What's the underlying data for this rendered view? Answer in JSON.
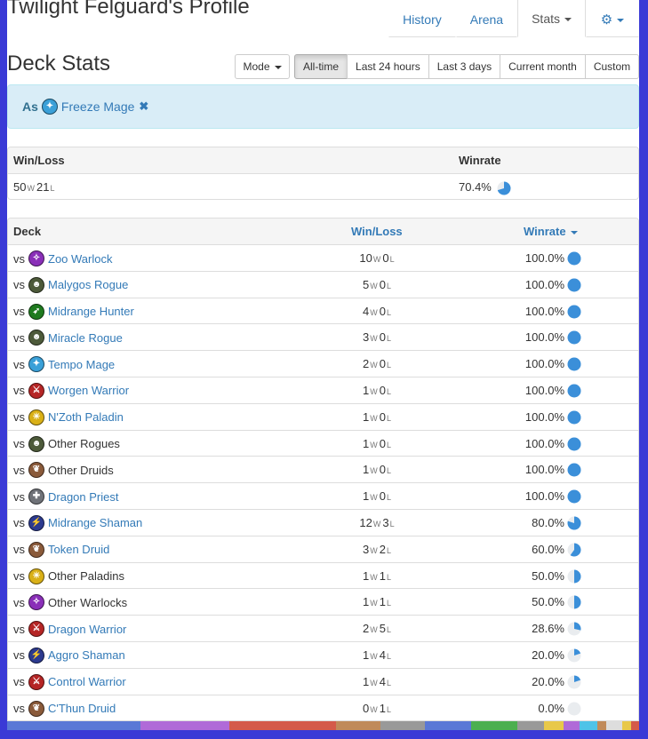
{
  "header": {
    "profile_title": "Twilight Felguard's Profile",
    "nav": [
      {
        "label": "History",
        "active": false
      },
      {
        "label": "Arena",
        "active": false
      },
      {
        "label": "Stats",
        "active": true
      }
    ],
    "settings_icon": "gear-icon"
  },
  "deck_stats": {
    "title": "Deck Stats",
    "mode_label": "Mode",
    "ranges": [
      "All-time",
      "Last 24 hours",
      "Last 3 days",
      "Current month",
      "Custom"
    ],
    "active_range": "All-time"
  },
  "filter": {
    "as_label": "As",
    "deck": "Freeze Mage",
    "deck_class": "mage",
    "remove_icon": "times-icon"
  },
  "summary": {
    "headers": {
      "winloss": "Win/Loss",
      "winrate": "Winrate"
    },
    "wins": "50",
    "losses": "21",
    "winrate": "70.4%",
    "winrate_value": 0.704
  },
  "table": {
    "headers": {
      "deck": "Deck",
      "winloss": "Win/Loss",
      "winrate": "Winrate"
    },
    "vs_label": "vs",
    "w_suffix": "W",
    "l_suffix": "L",
    "rows": [
      {
        "deck": "Zoo Warlock",
        "cls": "warlock",
        "link": true,
        "w": "10",
        "l": "0",
        "winrate": "100.0%",
        "rate": 1.0
      },
      {
        "deck": "Malygos Rogue",
        "cls": "rogue",
        "link": true,
        "w": "5",
        "l": "0",
        "winrate": "100.0%",
        "rate": 1.0
      },
      {
        "deck": "Midrange Hunter",
        "cls": "hunter",
        "link": true,
        "w": "4",
        "l": "0",
        "winrate": "100.0%",
        "rate": 1.0
      },
      {
        "deck": "Miracle Rogue",
        "cls": "rogue",
        "link": true,
        "w": "3",
        "l": "0",
        "winrate": "100.0%",
        "rate": 1.0
      },
      {
        "deck": "Tempo Mage",
        "cls": "mage",
        "link": true,
        "w": "2",
        "l": "0",
        "winrate": "100.0%",
        "rate": 1.0
      },
      {
        "deck": "Worgen Warrior",
        "cls": "warrior",
        "link": true,
        "w": "1",
        "l": "0",
        "winrate": "100.0%",
        "rate": 1.0
      },
      {
        "deck": "N'Zoth Paladin",
        "cls": "paladin",
        "link": true,
        "w": "1",
        "l": "0",
        "winrate": "100.0%",
        "rate": 1.0
      },
      {
        "deck": "Other Rogues",
        "cls": "rogue",
        "link": false,
        "w": "1",
        "l": "0",
        "winrate": "100.0%",
        "rate": 1.0
      },
      {
        "deck": "Other Druids",
        "cls": "druid",
        "link": false,
        "w": "1",
        "l": "0",
        "winrate": "100.0%",
        "rate": 1.0
      },
      {
        "deck": "Dragon Priest",
        "cls": "priest",
        "link": true,
        "w": "1",
        "l": "0",
        "winrate": "100.0%",
        "rate": 1.0
      },
      {
        "deck": "Midrange Shaman",
        "cls": "shaman",
        "link": true,
        "w": "12",
        "l": "3",
        "winrate": "80.0%",
        "rate": 0.8
      },
      {
        "deck": "Token Druid",
        "cls": "druid",
        "link": true,
        "w": "3",
        "l": "2",
        "winrate": "60.0%",
        "rate": 0.6
      },
      {
        "deck": "Other Paladins",
        "cls": "paladin",
        "link": false,
        "w": "1",
        "l": "1",
        "winrate": "50.0%",
        "rate": 0.5
      },
      {
        "deck": "Other Warlocks",
        "cls": "warlock",
        "link": false,
        "w": "1",
        "l": "1",
        "winrate": "50.0%",
        "rate": 0.5
      },
      {
        "deck": "Dragon Warrior",
        "cls": "warrior",
        "link": true,
        "w": "2",
        "l": "5",
        "winrate": "28.6%",
        "rate": 0.286
      },
      {
        "deck": "Aggro Shaman",
        "cls": "shaman",
        "link": true,
        "w": "1",
        "l": "4",
        "winrate": "20.0%",
        "rate": 0.2
      },
      {
        "deck": "Control Warrior",
        "cls": "warrior",
        "link": true,
        "w": "1",
        "l": "4",
        "winrate": "20.0%",
        "rate": 0.2
      },
      {
        "deck": "C'Thun Druid",
        "cls": "druid",
        "link": true,
        "w": "0",
        "l": "1",
        "winrate": "0.0%",
        "rate": 0.0
      }
    ]
  },
  "colors": {
    "link": "#337ab7",
    "pie_fill": "#3b8fd9",
    "pie_empty": "#e9ecef",
    "class_colors": {
      "warlock": "#8a2fb8",
      "rogue": "#4d5a3a",
      "hunter": "#1f7a1f",
      "mage": "#3aa0d8",
      "warrior": "#b52525",
      "paladin": "#d9b017",
      "druid": "#8a5a3a",
      "priest": "#6f7278",
      "shaman": "#2c3a8f"
    },
    "bottom_bar": [
      "#5a78d6",
      "#b06ad8",
      "#d45a4a",
      "#c08a5a",
      "#999999",
      "#5a78d6",
      "#4caf50",
      "#999999",
      "#e8c84a",
      "#b06ad8",
      "#4fc3e8",
      "#c08a5a",
      "#dddddd",
      "#e8c84a",
      "#d45a4a"
    ]
  }
}
